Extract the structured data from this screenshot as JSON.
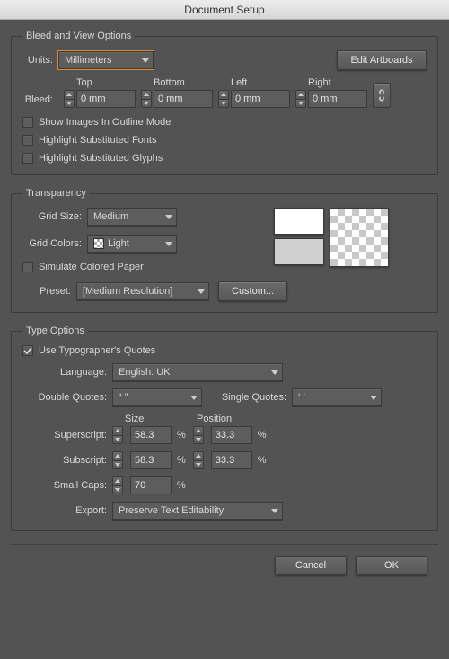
{
  "window": {
    "title": "Document Setup"
  },
  "bleed_section": {
    "legend": "Bleed and View Options",
    "units_label": "Units:",
    "units_value": "Millimeters",
    "edit_artboards": "Edit Artboards",
    "bleed_label": "Bleed:",
    "top_label": "Top",
    "bottom_label": "Bottom",
    "left_label": "Left",
    "right_label": "Right",
    "top": "0 mm",
    "bottom": "0 mm",
    "left": "0 mm",
    "right": "0 mm",
    "show_images": "Show Images In Outline Mode",
    "highlight_fonts": "Highlight Substituted Fonts",
    "highlight_glyphs": "Highlight Substituted Glyphs"
  },
  "transparency": {
    "legend": "Transparency",
    "grid_size_label": "Grid Size:",
    "grid_size_value": "Medium",
    "grid_colors_label": "Grid Colors:",
    "grid_colors_value": "Light",
    "simulate_paper": "Simulate Colored Paper",
    "preset_label": "Preset:",
    "preset_value": "[Medium Resolution]",
    "custom_button": "Custom...",
    "swatch1": "#ffffff",
    "swatch2": "#cfcfcf"
  },
  "type_options": {
    "legend": "Type Options",
    "use_typographers_quotes": "Use Typographer's Quotes",
    "language_label": "Language:",
    "language_value": "English: UK",
    "double_quotes_label": "Double Quotes:",
    "double_quotes_value": "“ ”",
    "single_quotes_label": "Single Quotes:",
    "single_quotes_value": "‘ ’",
    "size_header": "Size",
    "position_header": "Position",
    "superscript_label": "Superscript:",
    "superscript_size": "58.3",
    "superscript_pos": "33.3",
    "subscript_label": "Subscript:",
    "subscript_size": "58.3",
    "subscript_pos": "33.3",
    "smallcaps_label": "Small Caps:",
    "smallcaps_value": "70",
    "percent": "%",
    "export_label": "Export:",
    "export_value": "Preserve Text Editability"
  },
  "footer": {
    "cancel": "Cancel",
    "ok": "OK"
  }
}
